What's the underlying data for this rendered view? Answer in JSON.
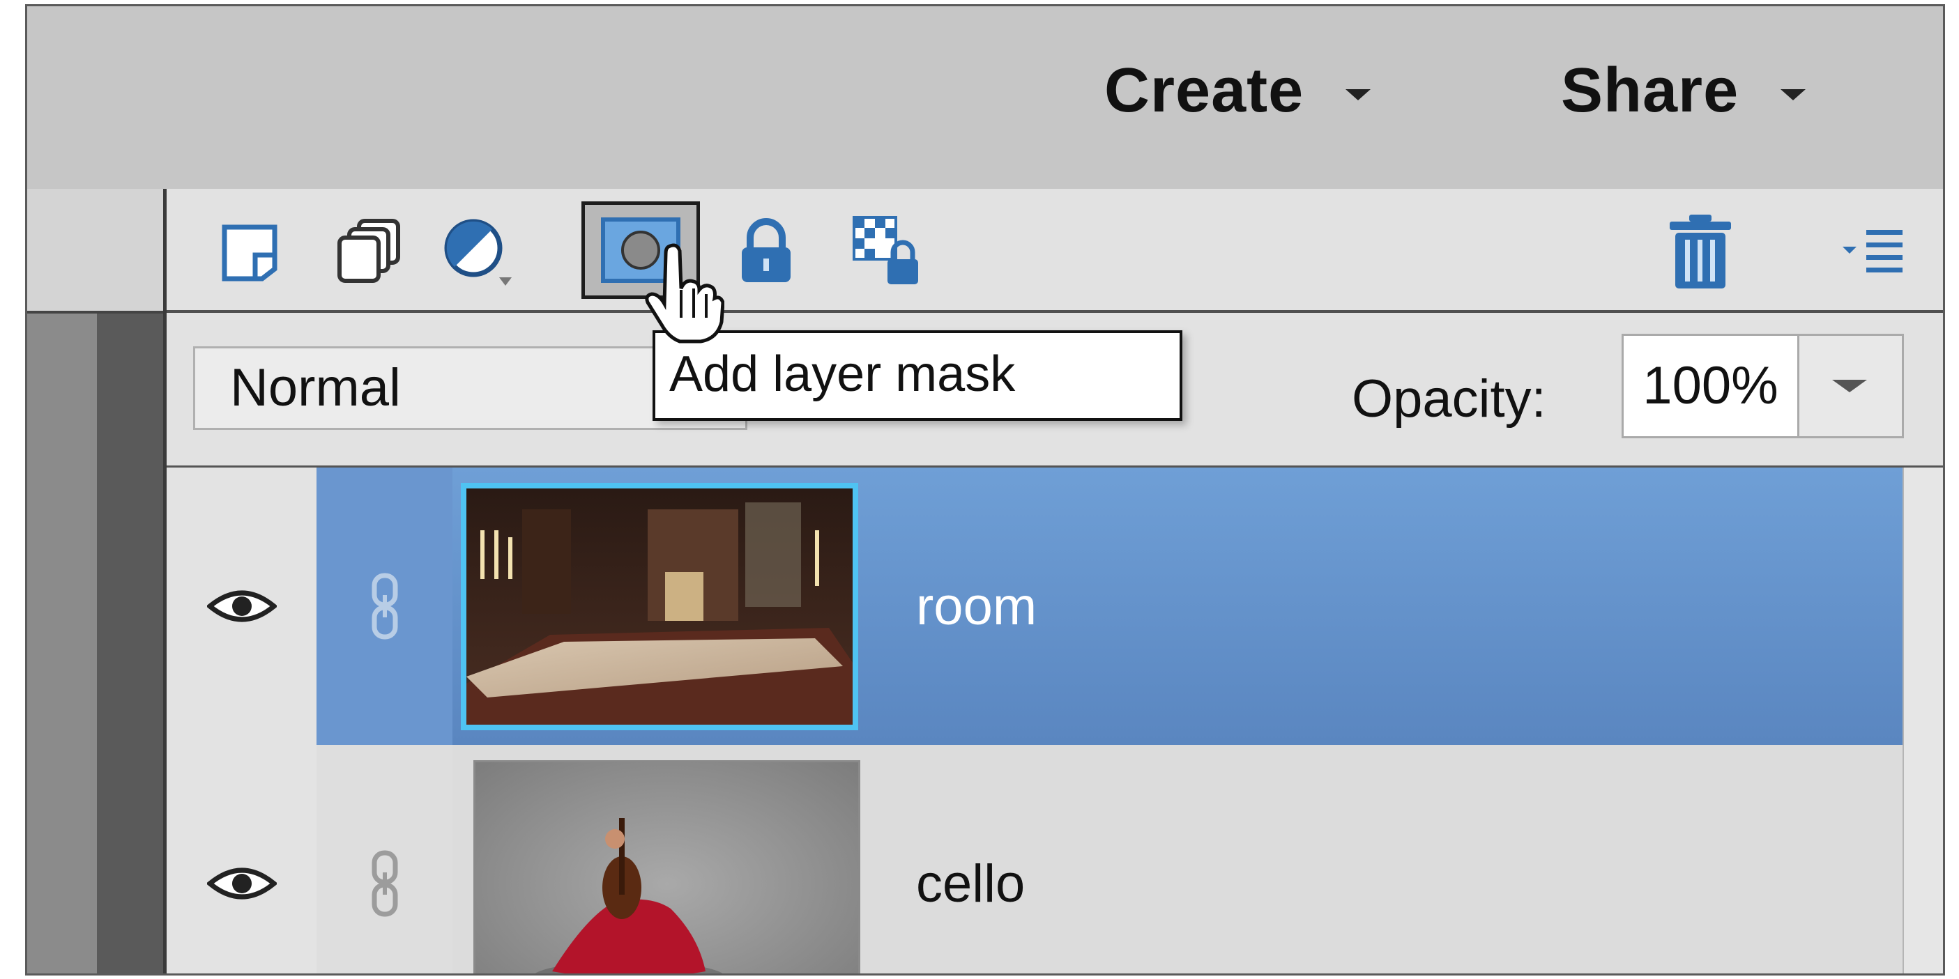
{
  "topbar": {
    "create_label": "Create",
    "share_label": "Share"
  },
  "toolbar": {
    "icons": [
      "new-layer-icon",
      "new-group-icon",
      "adjustment-layer-icon",
      "add-layer-mask-icon",
      "lock-all-icon",
      "lock-transparency-icon",
      "trash-icon",
      "panel-menu-icon"
    ],
    "active_tool": "add-layer-mask-icon"
  },
  "blend": {
    "mode": "Normal",
    "opacity_label": "Opacity:",
    "opacity_value": "100%"
  },
  "tooltip": {
    "text": "Add layer mask"
  },
  "layers": [
    {
      "name": "room",
      "selected": true
    },
    {
      "name": "cello",
      "selected": false
    }
  ],
  "colors": {
    "selected_row": "#5e8bc6",
    "thumb_highlight": "#4fc3f2",
    "icon_blue": "#2f6fb2"
  }
}
